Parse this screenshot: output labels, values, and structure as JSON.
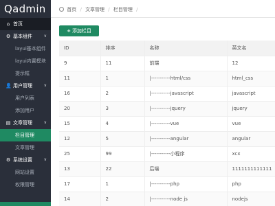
{
  "app": {
    "logo": "Qadmin"
  },
  "sidebar": {
    "items": [
      {
        "icon": "home-icon",
        "glyph": "⌂",
        "label": "首页",
        "type": "top"
      },
      {
        "icon": "grid-icon",
        "glyph": "⚙",
        "label": "基本组件",
        "type": "group"
      },
      {
        "label": "layui基本组件",
        "type": "sub"
      },
      {
        "label": "layui内置模块",
        "type": "sub"
      },
      {
        "label": "提示框",
        "type": "sub"
      },
      {
        "icon": "user-icon",
        "glyph": "👤",
        "label": "用户管理",
        "type": "group"
      },
      {
        "label": "用户列表",
        "type": "sub"
      },
      {
        "label": "添加用户",
        "type": "sub"
      },
      {
        "icon": "article-icon",
        "glyph": "▤",
        "label": "文章管理",
        "type": "group"
      },
      {
        "label": "栏目管理",
        "type": "sub",
        "active": true
      },
      {
        "label": "文章管理",
        "type": "sub"
      },
      {
        "icon": "settings-icon",
        "glyph": "⚙",
        "label": "系统设置",
        "type": "group"
      },
      {
        "label": "网站设置",
        "type": "sub"
      },
      {
        "label": "权限管理",
        "type": "sub"
      }
    ]
  },
  "breadcrumb": {
    "items": [
      "首页",
      "文章管理",
      "栏目管理"
    ],
    "trailing_sep": "/"
  },
  "toolbar": {
    "add_button_plus": "+",
    "add_button_label": "添加栏目"
  },
  "table": {
    "columns": [
      "ID",
      "排序",
      "名称",
      "英文名"
    ],
    "rows": [
      [
        "9",
        "11",
        "前端",
        "12"
      ],
      [
        "11",
        "1",
        "|-----------html/css",
        "html_css"
      ],
      [
        "16",
        "2",
        "|-----------javascript",
        "javascript"
      ],
      [
        "20",
        "3",
        "|-----------jquery",
        "jquery"
      ],
      [
        "15",
        "4",
        "|-----------vue",
        "vue"
      ],
      [
        "12",
        "5",
        "|-----------angular",
        "angular"
      ],
      [
        "25",
        "99",
        "|-----------小程序",
        "xcx"
      ],
      [
        "13",
        "22",
        "后端",
        "1111111111111"
      ],
      [
        "17",
        "1",
        "|-----------php",
        "php"
      ],
      [
        "14",
        "2",
        "|-----------node js",
        "nodejs"
      ]
    ]
  },
  "colors": {
    "sidebar_bg": "#2a2f3a",
    "accent": "#1f8a62"
  }
}
